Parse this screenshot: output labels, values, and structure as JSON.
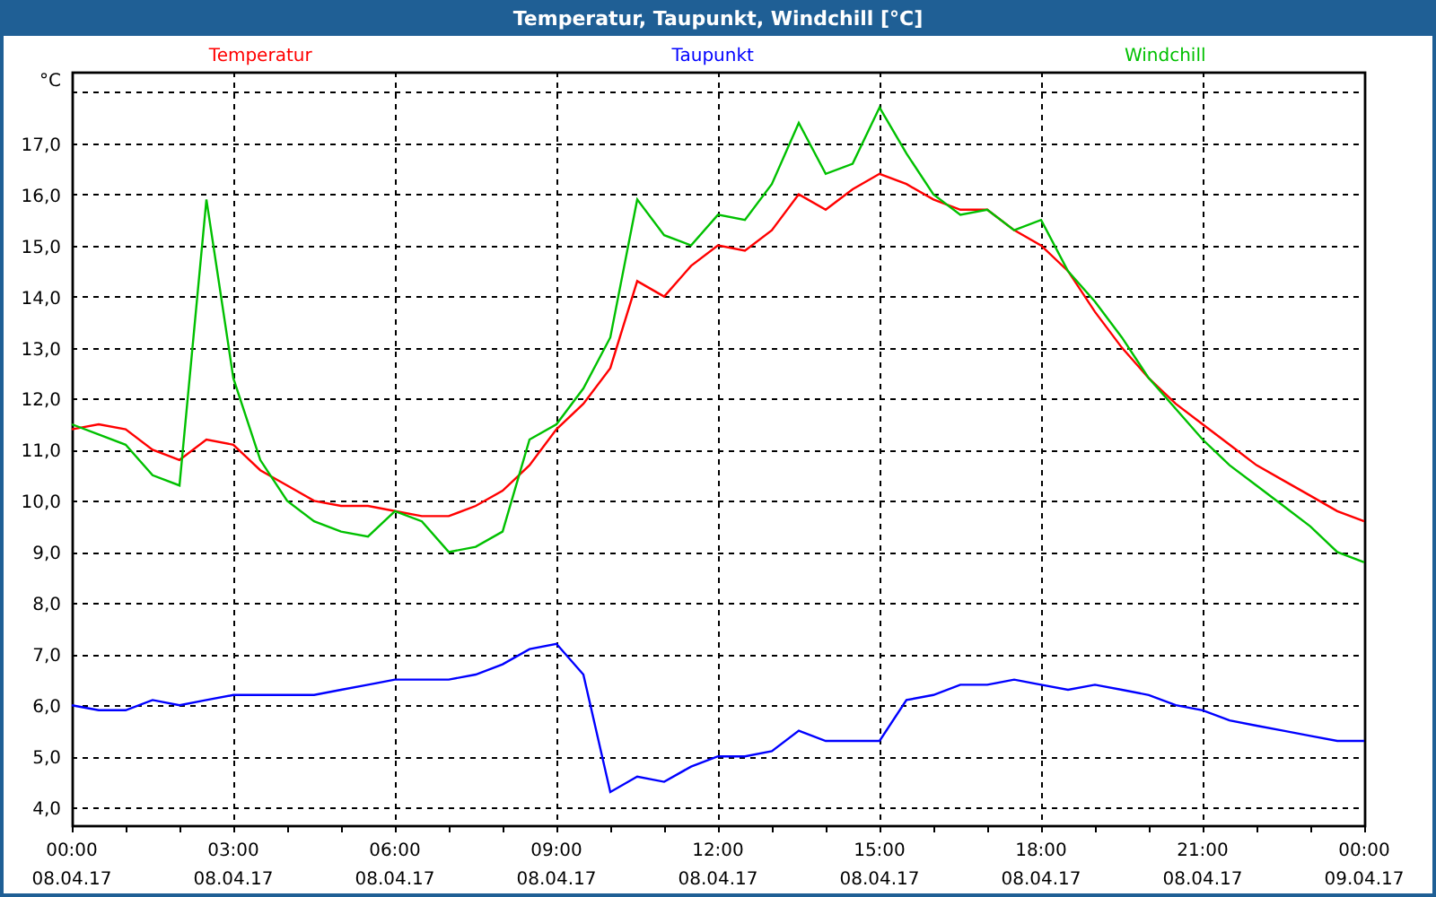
{
  "window": {
    "title": "Temperatur, Taupunkt, Windchill [°C]"
  },
  "chart": {
    "chart_data": {
      "type": "line",
      "ylabel": "°C",
      "categories": [
        "00:00\n08.04.17",
        null,
        null,
        null,
        null,
        null,
        "03:00\n08.04.17",
        null,
        null,
        null,
        null,
        null,
        "06:00\n08.04.17",
        null,
        null,
        null,
        null,
        null,
        "09:00\n08.04.17",
        null,
        null,
        null,
        null,
        null,
        "12:00\n08.04.17",
        null,
        null,
        null,
        null,
        null,
        "15:00\n08.04.17",
        null,
        null,
        null,
        null,
        null,
        "18:00\n08.04.17",
        null,
        null,
        null,
        null,
        null,
        "21:00\n08.04.17",
        null,
        null,
        null,
        null,
        null,
        "00:00\n09.04.17"
      ],
      "series": [
        {
          "name": "Temperatur",
          "color": "#ff0000",
          "values": [
            11.4,
            11.5,
            11.4,
            11.0,
            10.8,
            11.2,
            11.1,
            10.6,
            10.3,
            10.0,
            9.9,
            9.9,
            9.8,
            9.7,
            9.7,
            9.9,
            10.2,
            10.7,
            11.4,
            11.9,
            12.6,
            14.3,
            14.0,
            14.6,
            15.0,
            14.9,
            15.3,
            16.0,
            15.7,
            16.1,
            16.4,
            16.2,
            15.9,
            15.7,
            15.7,
            15.3,
            15.0,
            14.5,
            13.7,
            13.0,
            12.4,
            11.9,
            11.5,
            11.1,
            10.7,
            10.4,
            10.1,
            9.8,
            9.6
          ]
        },
        {
          "name": "Taupunkt",
          "color": "#0000ff",
          "values": [
            6.0,
            5.9,
            5.9,
            6.1,
            6.0,
            6.1,
            6.2,
            6.2,
            6.2,
            6.2,
            6.3,
            6.4,
            6.5,
            6.5,
            6.5,
            6.6,
            6.8,
            7.1,
            7.2,
            6.6,
            4.3,
            4.6,
            4.5,
            4.8,
            5.0,
            5.0,
            5.1,
            5.5,
            5.3,
            5.3,
            5.3,
            6.1,
            6.2,
            6.4,
            6.4,
            6.5,
            6.4,
            6.3,
            6.4,
            6.3,
            6.2,
            6.0,
            5.9,
            5.7,
            5.6,
            5.5,
            5.4,
            5.3,
            5.3
          ]
        },
        {
          "name": "Windchill",
          "color": "#00c000",
          "values": [
            11.5,
            11.3,
            11.1,
            10.5,
            10.3,
            15.9,
            12.4,
            10.8,
            10.0,
            9.6,
            9.4,
            9.3,
            9.8,
            9.6,
            9.0,
            9.1,
            9.4,
            11.2,
            11.5,
            12.2,
            13.2,
            15.9,
            15.2,
            15.0,
            15.6,
            15.5,
            16.2,
            17.4,
            16.4,
            16.6,
            17.7,
            16.8,
            16.0,
            15.6,
            15.7,
            15.3,
            15.5,
            14.5,
            13.9,
            13.2,
            12.4,
            11.8,
            11.2,
            10.7,
            10.3,
            9.9,
            9.5,
            9.0,
            8.8
          ]
        }
      ],
      "ylim": [
        3.65,
        18.4
      ],
      "grid": true,
      "yticks": [
        {
          "value": 4,
          "label": "4,0"
        },
        {
          "value": 5,
          "label": "5,0"
        },
        {
          "value": 6,
          "label": "6,0"
        },
        {
          "value": 7,
          "label": "7,0"
        },
        {
          "value": 8,
          "label": "8,0"
        },
        {
          "value": 9,
          "label": "9,0"
        },
        {
          "value": 10,
          "label": "10,0"
        },
        {
          "value": 11,
          "label": "11,0"
        },
        {
          "value": 12,
          "label": "12,0"
        },
        {
          "value": 13,
          "label": "13,0"
        },
        {
          "value": 14,
          "label": "14,0"
        },
        {
          "value": 15,
          "label": "15,0"
        },
        {
          "value": 16,
          "label": "16,0"
        },
        {
          "value": 17,
          "label": "17,0"
        }
      ]
    }
  }
}
